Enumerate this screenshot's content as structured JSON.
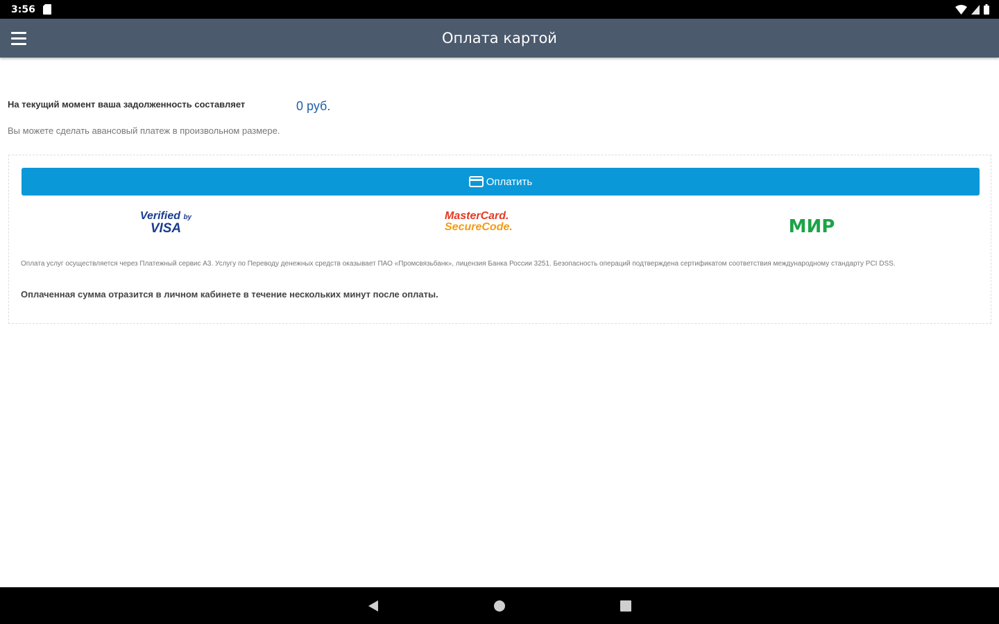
{
  "status_bar": {
    "time": "3:56",
    "icons": [
      "sd-card-icon",
      "wifi-icon",
      "signal-icon",
      "battery-icon"
    ]
  },
  "app_bar": {
    "title": "Оплата картой",
    "menu_icon": "hamburger-menu-icon"
  },
  "main": {
    "debt_text": "На текущий момент ваша задолженность составляет",
    "debt_amount": "0 руб.",
    "advance_text": "Вы можете сделать авансовый платеж в произвольном размере.",
    "pay_button_label": "Оплатить",
    "logos": {
      "visa_line1": "Verified",
      "visa_by": "by",
      "visa_line2": "VISA",
      "mastercard_line1": "MasterCard.",
      "mastercard_line2": "SecureCode.",
      "mir": "МИР"
    },
    "legal_text": "Оплата услуг осуществляется через Платежный сервис A3. Услугу по Переводу денежных средств оказывает ПАО «Промсвязьбанк», лицензия Банка России 3251. Безопасность операций подтверждена сертификатом соответствия международному стандарту PCI DSS.",
    "notice_text": "Оплаченная сумма отразится в личном кабинете в течение нескольких минут после оплаты."
  },
  "colors": {
    "app_bar": "#4b5a6c",
    "pay_button": "#0b98d8",
    "amount": "#1f5fa8",
    "mir": "#1ba446"
  },
  "nav_bar": {
    "icons": [
      "back-icon",
      "home-icon",
      "recent-apps-icon"
    ]
  }
}
